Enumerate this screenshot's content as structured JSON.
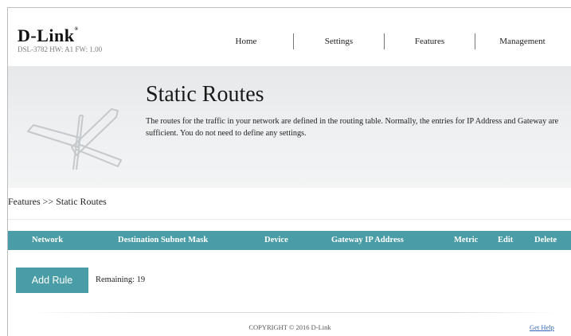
{
  "brand": {
    "logo": "D-Link",
    "model_info": "DSL-3782  HW: A1  FW: 1.00"
  },
  "nav": {
    "items": [
      "Home",
      "Settings",
      "Features",
      "Management"
    ]
  },
  "banner": {
    "title": "Static Routes",
    "description": "The routes for the traffic in your network are defined in the routing table. Normally, the entries for IP Address and Gateway are sufficient. You do not need to define any settings."
  },
  "breadcrumb": "Features >> Static Routes",
  "table": {
    "columns": [
      "Network",
      "Destination Subnet Mask",
      "Device",
      "Gateway IP Address",
      "Metric",
      "Edit",
      "Delete"
    ],
    "header_color": "#4a9ca6"
  },
  "actions": {
    "add_rule_label": "Add Rule",
    "remaining_text": "Remaining: 19"
  },
  "footer": {
    "copyright": "COPYRIGHT © 2016 D-Link",
    "help_link": "Get Help"
  }
}
